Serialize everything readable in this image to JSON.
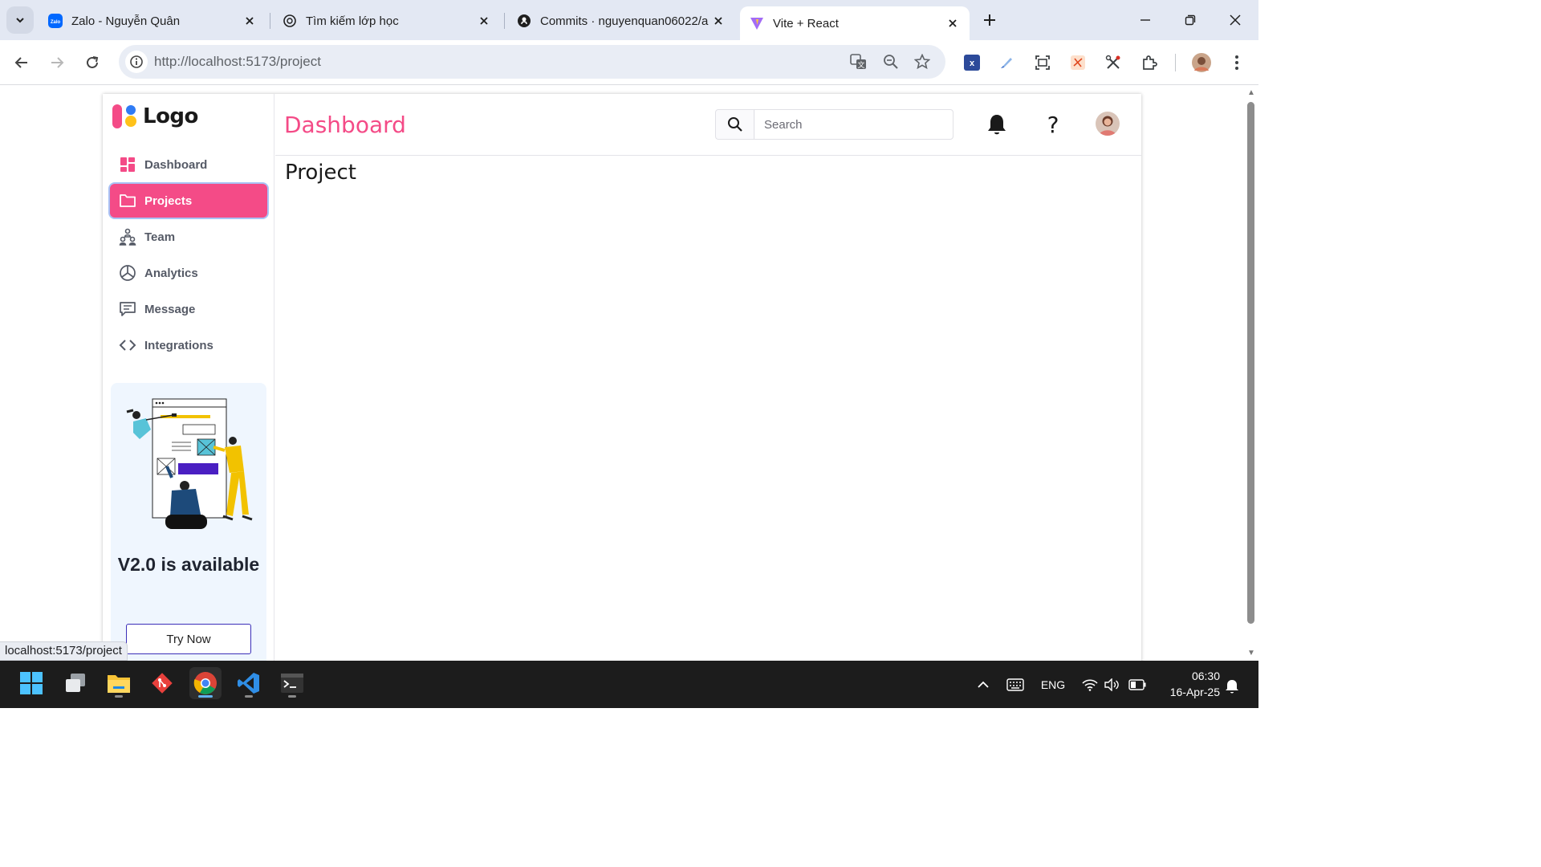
{
  "browser": {
    "tabs": [
      {
        "title": "Zalo - Nguyễn Quân",
        "icon": "zalo-icon"
      },
      {
        "title": "Tìm kiếm lớp học",
        "icon": "openai-icon"
      },
      {
        "title": "Commits · nguyenquan06022/a",
        "icon": "github-icon"
      },
      {
        "title": "Vite + React",
        "icon": "vite-icon",
        "active": true
      }
    ],
    "zalo_favicon_text": "Zalo",
    "url_host": "http://localhost",
    "url_path": ":5173/project",
    "status_url": "localhost:5173/project"
  },
  "app": {
    "logo_text": "Logo",
    "header_title": "Dashboard",
    "search_placeholder": "Search",
    "help_label": "?",
    "nav": [
      {
        "label": "Dashboard",
        "icon": "dashboard-grid-icon"
      },
      {
        "label": "Projects",
        "icon": "folder-icon",
        "active": true
      },
      {
        "label": "Team",
        "icon": "team-icon"
      },
      {
        "label": "Analytics",
        "icon": "pie-chart-icon"
      },
      {
        "label": "Message",
        "icon": "message-icon"
      },
      {
        "label": "Integrations",
        "icon": "code-icon"
      }
    ],
    "promo": {
      "title": "V2.0 is available",
      "button": "Try Now"
    },
    "content_heading": "Project",
    "accent_color": "#f44b87"
  },
  "taskbar": {
    "apps": [
      "windows-start-icon",
      "task-view-icon",
      "file-explorer-icon",
      "git-icon",
      "chrome-icon",
      "vscode-icon",
      "terminal-icon"
    ],
    "language": "ENG",
    "time": "06:30",
    "date": "16-Apr-25"
  }
}
